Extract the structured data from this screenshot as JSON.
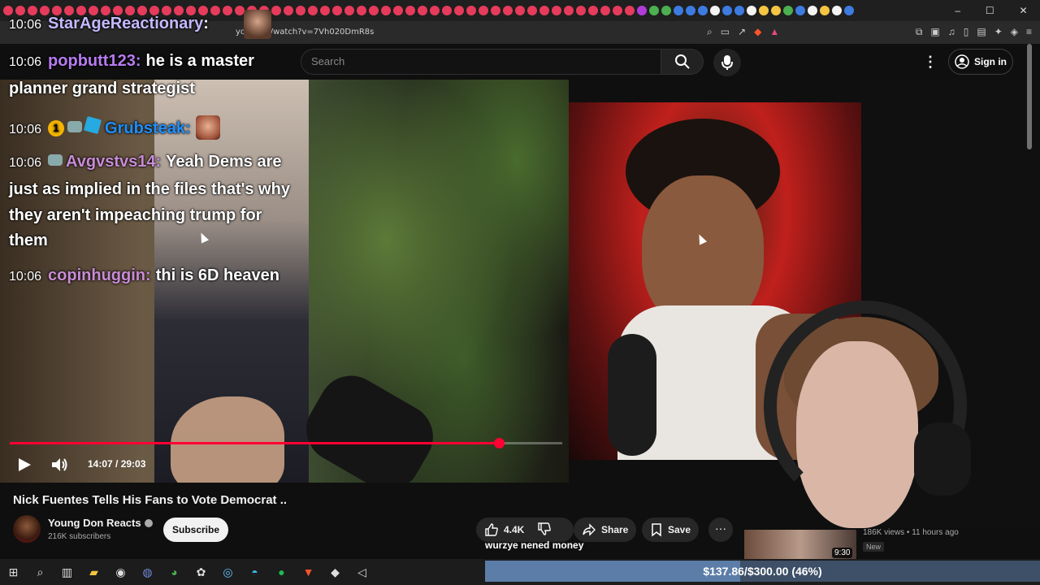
{
  "browser": {
    "url": "yo...com/watch?v=7Vh020DmR8s",
    "tab_colors": [
      "#e63b5b",
      "#e63b5b",
      "#e63b5b",
      "#e63b5b",
      "#e63b5b",
      "#e63b5b",
      "#e63b5b",
      "#e63b5b",
      "#e63b5b",
      "#e63b5b",
      "#e63b5b",
      "#e63b5b",
      "#e63b5b",
      "#e63b5b",
      "#e63b5b",
      "#e63b5b",
      "#e63b5b",
      "#e63b5b",
      "#e63b5b",
      "#e63b5b",
      "#e63b5b",
      "#e63b5b",
      "#e63b5b",
      "#e63b5b",
      "#e63b5b",
      "#e63b5b",
      "#e63b5b",
      "#e63b5b",
      "#e63b5b",
      "#e63b5b",
      "#e63b5b",
      "#e63b5b",
      "#e63b5b",
      "#e63b5b",
      "#e63b5b",
      "#e63b5b",
      "#e63b5b",
      "#e63b5b",
      "#e63b5b",
      "#e63b5b",
      "#e63b5b",
      "#e63b5b",
      "#e63b5b",
      "#e63b5b",
      "#e63b5b",
      "#e63b5b",
      "#e63b5b",
      "#e63b5b",
      "#e63b5b",
      "#e63b5b",
      "#e63b5b",
      "#e63b5b",
      "#b03bd8",
      "#4caf50",
      "#4caf50",
      "#3d7be0",
      "#3d7be0",
      "#3d7be0",
      "#f4f4f4",
      "#3d7be0",
      "#3d7be0",
      "#f4f4f4",
      "#f4c542",
      "#f4c542",
      "#4caf50",
      "#3d7be0",
      "#f4f4f4",
      "#f4c542",
      "#f4f4f4",
      "#3d7be0"
    ],
    "window_controls": [
      "–",
      "☐",
      "✕"
    ]
  },
  "youtube": {
    "search_placeholder": "Search",
    "signin_label": "Sign in"
  },
  "player": {
    "current_time": "14:07",
    "duration": "29:03",
    "time_display": "14:07 / 29:03",
    "progress": 0.886
  },
  "video": {
    "title": "Nick Fuentes Tells His Fans to Vote Democrat ..",
    "channel_name": "Young Don Reacts",
    "subscribers": "216K subscribers",
    "subscribe_label": "Subscribe",
    "likes": "4.4K",
    "share_label": "Share",
    "save_label": "Save",
    "more_label": "···"
  },
  "recommendation": {
    "meta": "186K views • 11 hours ago",
    "badge": "New",
    "duration": "9:30"
  },
  "chat": {
    "top": {
      "ts": "10:06",
      "user": "StarAgeReactionary",
      "sep": ":"
    },
    "lines": [
      {
        "ts": "10:06",
        "user": "popbutt123",
        "sep": ":",
        "msg": "he is a master",
        "user_color": "#b77bf0"
      },
      {
        "ts": "",
        "user": "",
        "sep": "",
        "msg": "planner grand strategist",
        "user_color": "#ffffff"
      },
      {
        "ts": "10:06",
        "user": "Grubsteak",
        "sep": ":",
        "msg": "",
        "user_color": "#1e90ff"
      },
      {
        "ts": "10:06",
        "user": "Avgvstvs14",
        "sep": ":",
        "msg": "Yeah Dems are",
        "user_color": "#c98bd6"
      },
      {
        "ts": "",
        "user": "",
        "sep": "",
        "msg": "just as implied in the files that's why",
        "user_color": "#ffffff"
      },
      {
        "ts": "",
        "user": "",
        "sep": "",
        "msg": "they aren't impeaching trump for",
        "user_color": "#ffffff"
      },
      {
        "ts": "",
        "user": "",
        "sep": "",
        "msg": "them",
        "user_color": "#ffffff"
      },
      {
        "ts": "10:06",
        "user": "copinhuggin",
        "sep": ":",
        "msg": "thi is 6D heaven",
        "user_color": "#c98bd6"
      }
    ],
    "badge_gold": "1"
  },
  "stream_overlay": {
    "donation_message": "wurzye nened money",
    "goal_text": "$137.86/$300.00 (46%)",
    "goal_fraction": 0.46
  },
  "taskbar": {
    "icons": [
      "windows-icon",
      "search-icon",
      "task-view-icon",
      "file-explorer-icon",
      "obs-icon",
      "discord-icon",
      "chrome-icon",
      "app-icon",
      "steam-icon",
      "edge-icon",
      "spotify-icon",
      "brave-icon",
      "app2-icon",
      "volume-icon"
    ]
  },
  "colors": {
    "accent_red": "#ff0033",
    "bg": "#0f0f0f"
  }
}
